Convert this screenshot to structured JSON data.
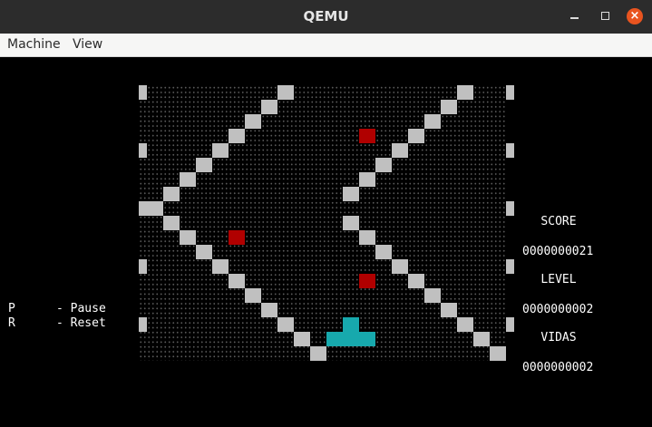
{
  "window": {
    "title": "QEMU"
  },
  "menu": {
    "items": [
      "Machine",
      "View"
    ]
  },
  "hud": {
    "score_label": "SCORE",
    "score_value": "0000000021",
    "level_label": "LEVEL",
    "level_value": "0000000002",
    "lives_label": "VIDAS",
    "lives_value": "0000000002"
  },
  "controls": [
    {
      "key": "P",
      "action": "- Pause"
    },
    {
      "key": "R",
      "action": "- Reset"
    }
  ],
  "colors": {
    "wall": "#c0c0c0",
    "enemy": "#b00000",
    "player": "#17a9ad",
    "close_button": "#e9541f"
  }
}
